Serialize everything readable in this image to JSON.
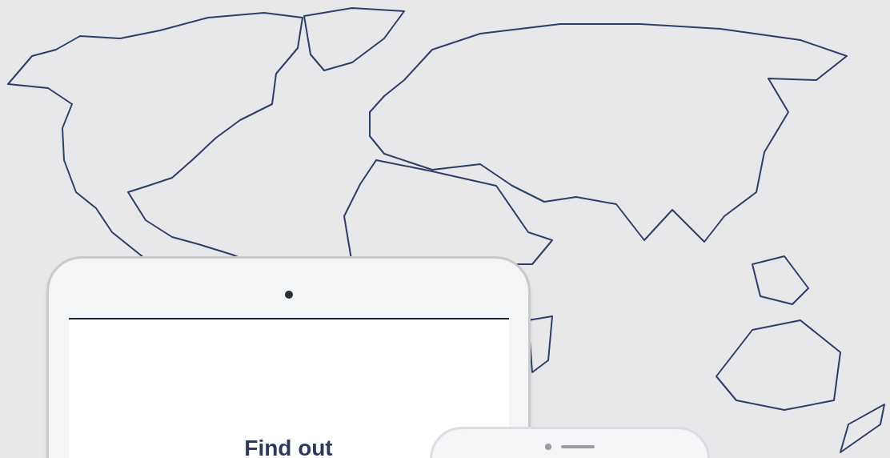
{
  "hero": {
    "heading": "Find out"
  }
}
